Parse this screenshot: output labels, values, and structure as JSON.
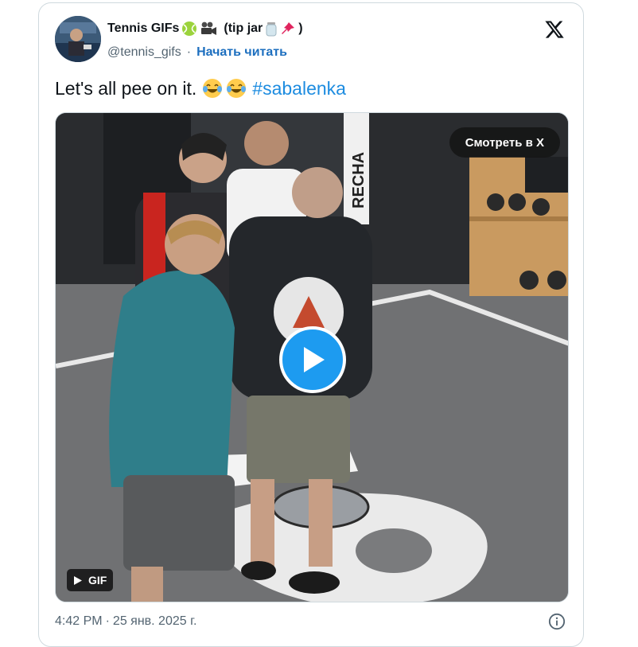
{
  "author": {
    "name": "Tennis GIFs",
    "name_suffix": "(tip jar",
    "name_suffix_end": ")",
    "handle": "@tennis_gifs",
    "separator": "·",
    "follow_label": "Начать читать",
    "name_emojis": [
      "tennis-ball",
      "movie-camera"
    ],
    "tip_emojis": [
      "jar",
      "pushpin"
    ]
  },
  "tweet": {
    "text": "Let's all pee on it.",
    "emojis": [
      "face-with-tears-of-joy",
      "face-with-tears-of-joy"
    ],
    "hashtag": "#sabalenka"
  },
  "media": {
    "watch_label": "Смотреть в X",
    "media_type_label": "GIF",
    "wall_text": "RECHA"
  },
  "footer": {
    "time": "4:42 PM",
    "separator": "·",
    "date": "25 янв. 2025 г."
  },
  "colors": {
    "accent": "#1d9bf0",
    "follow": "#1d6fbf",
    "muted": "#536471"
  },
  "icons": {
    "platform": "x-logo-icon",
    "info": "info-icon",
    "play": "play-icon"
  }
}
